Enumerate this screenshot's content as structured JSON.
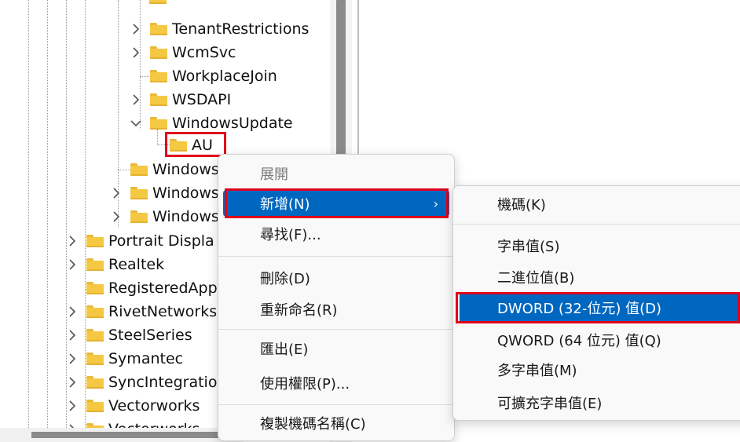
{
  "tree": {
    "items": [
      {
        "label": "TenantRestrictions",
        "expandable": true
      },
      {
        "label": "WcmSvc",
        "expandable": true
      },
      {
        "label": "WorkplaceJoin",
        "expandable": false
      },
      {
        "label": "WSDAPI",
        "expandable": true
      },
      {
        "label": "WindowsUpdate",
        "expandable": true,
        "expanded": true
      },
      {
        "label": "AU",
        "expandable": false,
        "selected": true
      },
      {
        "label": "Windows",
        "expandable": false
      },
      {
        "label": "Windows",
        "expandable": true
      },
      {
        "label": "Windows",
        "expandable": true
      },
      {
        "label": "Portrait Displa",
        "expandable": true
      },
      {
        "label": "Realtek",
        "expandable": true
      },
      {
        "label": "RegisteredApp",
        "expandable": false
      },
      {
        "label": "RivetNetworks",
        "expandable": true
      },
      {
        "label": "SteelSeries",
        "expandable": true
      },
      {
        "label": "Symantec",
        "expandable": true
      },
      {
        "label": "SyncIntegratio",
        "expandable": true
      },
      {
        "label": "Vectorworks",
        "expandable": true
      },
      {
        "label": "Vectorworks",
        "expandable": true
      }
    ]
  },
  "context_menu": {
    "items": [
      {
        "label": "展開",
        "disabled": true
      },
      {
        "label": "新增(N)",
        "has_submenu": true,
        "highlighted": true
      },
      {
        "label": "尋找(F)..."
      },
      {
        "label": "刪除(D)"
      },
      {
        "label": "重新命名(R)"
      },
      {
        "label": "匯出(E)"
      },
      {
        "label": "使用權限(P)..."
      },
      {
        "label": "複製機碼名稱(C)"
      }
    ],
    "submenu_arrow": "›"
  },
  "submenu": {
    "items": [
      {
        "label": "機碼(K)"
      },
      {
        "label": "字串值(S)"
      },
      {
        "label": "二進位值(B)"
      },
      {
        "label": "DWORD (32-位元) 值(D)",
        "highlighted": true
      },
      {
        "label": "QWORD (64 位元) 值(Q)"
      },
      {
        "label": "多字串值(M)"
      },
      {
        "label": "可擴充字串值(E)"
      }
    ]
  },
  "colors": {
    "highlight": "#0067c0",
    "annotation_red": "#e0001a",
    "folder": "#f5c844"
  }
}
